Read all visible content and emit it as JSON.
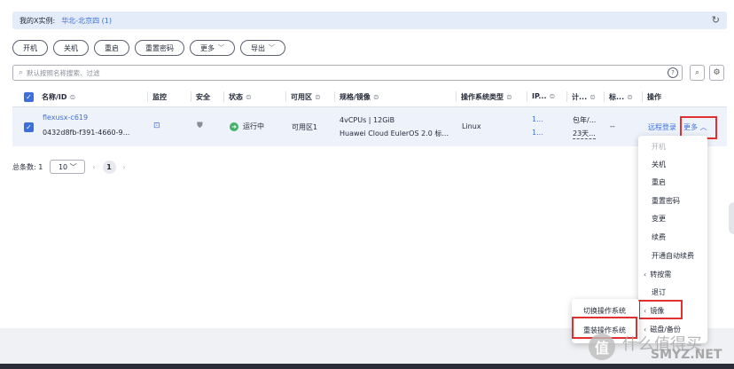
{
  "region": {
    "label": "我的X实例:",
    "value": "华北-北京四 (1)",
    "refresh_icon": "refresh-icon"
  },
  "toolbar": {
    "start": "开机",
    "stop": "关机",
    "restart": "重启",
    "reset_password": "重置密码",
    "more": "更多",
    "export": "导出"
  },
  "search": {
    "placeholder": "默认按照名称搜索、过滤"
  },
  "table": {
    "headers": {
      "name": "名称/ID",
      "monitor": "监控",
      "security": "安全",
      "status": "状态",
      "zone": "可用区",
      "spec": "规格/镜像",
      "os_type": "操作系统类型",
      "ip": "IP...",
      "billing": "计...",
      "tag": "标...",
      "action": "操作"
    },
    "row": {
      "name": "flexusx-c619",
      "id": "0432d8fb-f391-4660-9...",
      "status": "运行中",
      "zone": "可用区1",
      "spec": "4vCPUs | 12GiB",
      "image": "Huawei Cloud EulerOS 2.0 标...",
      "os": "Linux",
      "ip1": "1...",
      "ip2": "1...",
      "billing1": "包年/...",
      "billing2": "23天...",
      "tag": "--",
      "remote_login": "远程登录",
      "more": "更多"
    }
  },
  "pager": {
    "total": "总条数: 1",
    "page_size": "10",
    "current": "1"
  },
  "more_menu": {
    "items": [
      "开机",
      "关机",
      "重启",
      "重置密码",
      "变更",
      "续费",
      "开通自动续费",
      "转按需",
      "退订",
      "镜像",
      "磁盘/备份"
    ]
  },
  "image_submenu": {
    "items": [
      "切换操作系统",
      "重装操作系统"
    ]
  },
  "watermark": {
    "brand1": "什么值得买",
    "brand2": "SMYZ.NET",
    "logo_char": "值"
  },
  "colors": {
    "accent": "#3d6fdb",
    "highlight": "#e03030",
    "running": "#45b26b"
  }
}
